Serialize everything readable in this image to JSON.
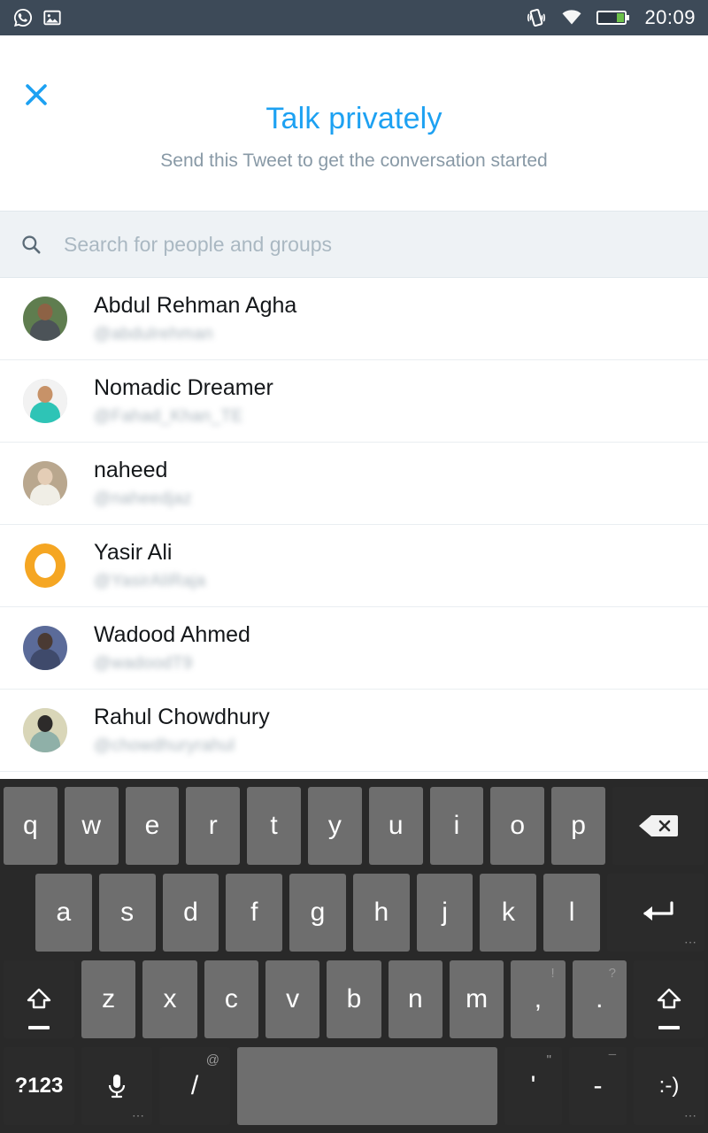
{
  "statusbar": {
    "left_icons": [
      "whatsapp-icon",
      "photo-icon"
    ],
    "right_icons": [
      "vibrate-icon",
      "wifi-icon",
      "battery-icon"
    ],
    "time": "20:09"
  },
  "header": {
    "close_label": "✕",
    "title": "Talk privately",
    "subtitle": "Send this Tweet to get the conversation started",
    "title_color": "#1da1f2",
    "subtitle_color": "#8899a6"
  },
  "search": {
    "placeholder": "Search for people and groups",
    "value": "",
    "icon": "search-icon"
  },
  "people": [
    {
      "name": "Abdul Rehman Agha",
      "handle": "@abdulrehman",
      "avatar_type": "photo",
      "avatar_bg": "#5f7d4f",
      "avatar_body": "#4c5358",
      "avatar_head": "#8d6245"
    },
    {
      "name": "Nomadic Dreamer",
      "handle": "@Fahad_Khan_TE",
      "avatar_type": "photo",
      "avatar_bg": "#f2f2f2",
      "avatar_body": "#2ec4b6",
      "avatar_head": "#c79268"
    },
    {
      "name": "naheed",
      "handle": "@naheedjaz",
      "avatar_type": "photo",
      "avatar_bg": "#b9a78e",
      "avatar_body": "#f0eee6",
      "avatar_head": "#e4cdb6"
    },
    {
      "name": "Yasir Ali",
      "handle": "@YasirAliRaja",
      "avatar_type": "ring",
      "avatar_bg": "#f5a623",
      "avatar_body": "#f5a623",
      "avatar_head": "#ffffff"
    },
    {
      "name": "Wadood Ahmed",
      "handle": "@wadoodT9",
      "avatar_type": "photo",
      "avatar_bg": "#5b6b99",
      "avatar_body": "#3f4a6b",
      "avatar_head": "#4a3a33"
    },
    {
      "name": "Rahul Chowdhury",
      "handle": "@chowdhuryrahul",
      "avatar_type": "photo",
      "avatar_bg": "#d9d6b8",
      "avatar_body": "#8fb0a8",
      "avatar_head": "#2d2b2a"
    }
  ],
  "keyboard": {
    "row1": [
      {
        "label": "q"
      },
      {
        "label": "w"
      },
      {
        "label": "e"
      },
      {
        "label": "r"
      },
      {
        "label": "t"
      },
      {
        "label": "y"
      },
      {
        "label": "u"
      },
      {
        "label": "i"
      },
      {
        "label": "o"
      },
      {
        "label": "p"
      }
    ],
    "backspace": {
      "name": "backspace-key",
      "label": ""
    },
    "row2": [
      {
        "label": "a"
      },
      {
        "label": "s"
      },
      {
        "label": "d"
      },
      {
        "label": "f"
      },
      {
        "label": "g"
      },
      {
        "label": "h"
      },
      {
        "label": "j"
      },
      {
        "label": "k"
      },
      {
        "label": "l"
      }
    ],
    "enter": {
      "name": "enter-key",
      "label": ""
    },
    "row3": [
      {
        "label": "z"
      },
      {
        "label": "x"
      },
      {
        "label": "c"
      },
      {
        "label": "v"
      },
      {
        "label": "b"
      },
      {
        "label": "n"
      },
      {
        "label": "m"
      }
    ],
    "comma": {
      "label": ",",
      "sup": "!"
    },
    "period": {
      "label": ".",
      "sup": "?"
    },
    "shift_left": {
      "label": ""
    },
    "shift_right": {
      "label": ""
    },
    "symbols": {
      "label": "?123"
    },
    "mic": {
      "label": ""
    },
    "slash": {
      "label": "/",
      "sup": "@"
    },
    "space": {
      "label": ""
    },
    "apostrophe": {
      "label": "'",
      "sup": "\""
    },
    "dash": {
      "label": "-",
      "sup": "¯"
    },
    "emoji": {
      "label": ":-)"
    }
  }
}
